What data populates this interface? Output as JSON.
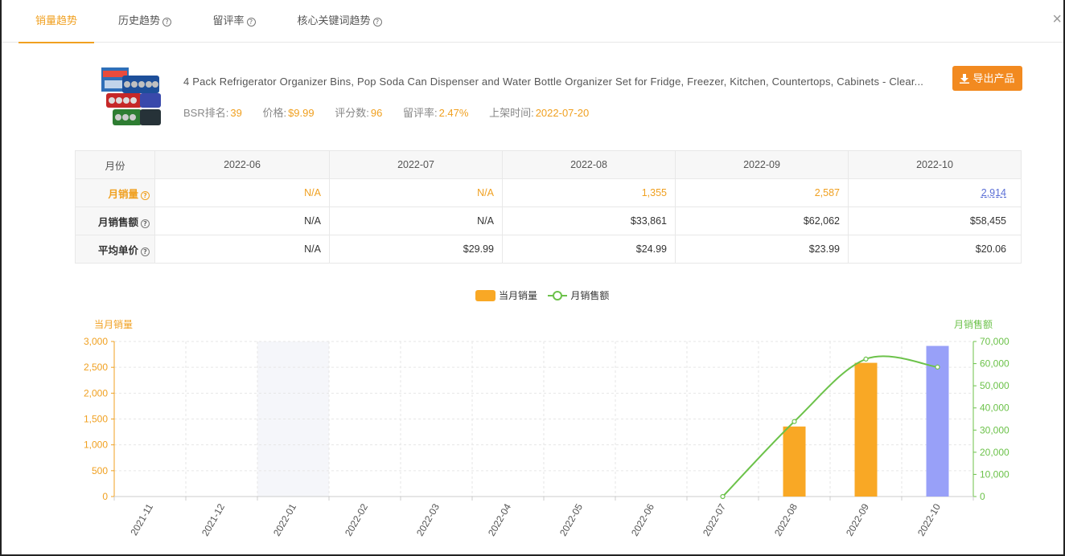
{
  "tabs": [
    {
      "label": "销量趋势",
      "active": true,
      "help": false
    },
    {
      "label": "历史趋势",
      "active": false,
      "help": true
    },
    {
      "label": "留评率",
      "active": false,
      "help": true
    },
    {
      "label": "核心关键词趋势",
      "active": false,
      "help": true
    }
  ],
  "close_label": "×",
  "product": {
    "title": "4 Pack Refrigerator Organizer Bins, Pop Soda Can Dispenser and Water Bottle Organizer Set for Fridge, Freezer, Kitchen, Countertops, Cabinets - Clear...",
    "bsr_label": "BSR排名:",
    "bsr": "39",
    "price_label": "价格:",
    "price": "$9.99",
    "reviews_label": "评分数:",
    "reviews": "96",
    "review_rate_label": "留评率:",
    "review_rate": "2.47%",
    "launch_label": "上架时间:",
    "launch": "2022-07-20",
    "export_label": "导出产品"
  },
  "table": {
    "header_label": "月份",
    "months": [
      "2022-06",
      "2022-07",
      "2022-08",
      "2022-09",
      "2022-10"
    ],
    "rows": [
      {
        "label": "月销量",
        "values": [
          "N/A",
          "N/A",
          "1,355",
          "2,587",
          "2,914"
        ]
      },
      {
        "label": "月销售额",
        "values": [
          "N/A",
          "N/A",
          "$33,861",
          "$62,062",
          "$58,455"
        ]
      },
      {
        "label": "平均单价",
        "values": [
          "N/A",
          "$29.99",
          "$24.99",
          "$23.99",
          "$20.06"
        ]
      }
    ]
  },
  "colors": {
    "accent": "#f0a020",
    "bar": "#f9a825",
    "bar_highlight": "#98a0f8",
    "line": "#6cc24a"
  },
  "chart_data": {
    "type": "bar",
    "legend": [
      "当月销量",
      "月销售额"
    ],
    "categories": [
      "2021-11",
      "2021-12",
      "2022-01",
      "2022-02",
      "2022-03",
      "2022-04",
      "2022-05",
      "2022-06",
      "2022-07",
      "2022-08",
      "2022-09",
      "2022-10"
    ],
    "series": [
      {
        "name": "当月销量",
        "type": "bar",
        "axis": "left",
        "values": [
          null,
          null,
          null,
          null,
          null,
          null,
          null,
          null,
          null,
          1355,
          2587,
          2914
        ]
      },
      {
        "name": "月销售额",
        "type": "line",
        "axis": "right",
        "values": [
          null,
          null,
          null,
          null,
          null,
          null,
          null,
          null,
          0,
          33861,
          62062,
          58455
        ]
      }
    ],
    "ylabel_left": "当月销量",
    "ylabel_right": "月销售额",
    "ylim_left": [
      0,
      3000
    ],
    "ylim_right": [
      0,
      70000
    ],
    "yticks_left": [
      "0",
      "500",
      "1,000",
      "1,500",
      "2,000",
      "2,500",
      "3,000"
    ],
    "yticks_right": [
      "0",
      "10,000",
      "20,000",
      "30,000",
      "40,000",
      "50,000",
      "60,000",
      "70,000"
    ],
    "highlighted_category": "2022-01",
    "highlighted_bar": "2022-10",
    "legend_position": "top-center",
    "grid": true
  }
}
